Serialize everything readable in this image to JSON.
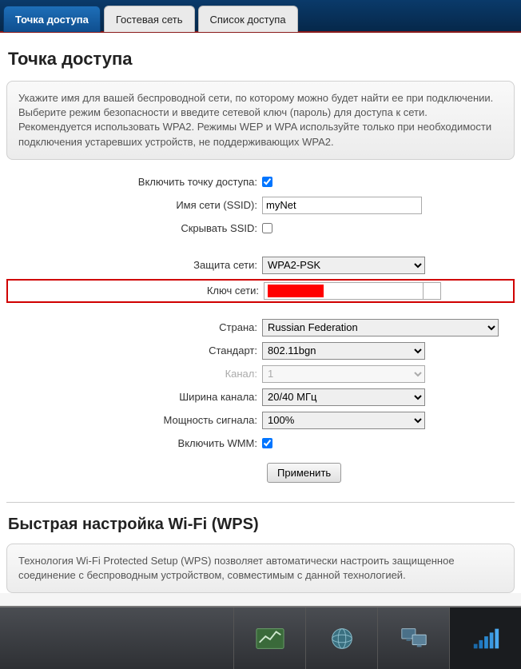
{
  "tabs": {
    "items": [
      {
        "label": "Точка доступа",
        "active": true
      },
      {
        "label": "Гостевая сеть",
        "active": false
      },
      {
        "label": "Список доступа",
        "active": false
      }
    ]
  },
  "page": {
    "title": "Точка доступа",
    "intro": "Укажите имя для вашей беспроводной сети, по которому можно будет найти ее при подключении. Выберите режим безопасности и введите сетевой ключ (пароль) для доступа к сети. Рекомендуется использовать WPA2. Режимы WEP и WPA используйте только при необходимости подключения устаревших устройств, не поддерживающих WPA2."
  },
  "form": {
    "enable_label": "Включить точку доступа:",
    "enable_checked": true,
    "ssid_label": "Имя сети (SSID):",
    "ssid_value": "myNet",
    "hide_ssid_label": "Скрывать SSID:",
    "hide_ssid_checked": false,
    "security_label": "Защита сети:",
    "security_value": "WPA2-PSK",
    "key_label": "Ключ сети:",
    "country_label": "Страна:",
    "country_value": "Russian Federation",
    "standard_label": "Стандарт:",
    "standard_value": "802.11bgn",
    "channel_label": "Канал:",
    "channel_value": "1",
    "width_label": "Ширина канала:",
    "width_value": "20/40 МГц",
    "power_label": "Мощность сигнала:",
    "power_value": "100%",
    "wmm_label": "Включить WMM:",
    "wmm_checked": true,
    "apply_label": "Применить"
  },
  "wps": {
    "title": "Быстрая настройка Wi-Fi (WPS)",
    "intro": "Технология Wi-Fi Protected Setup (WPS) позволяет автоматически настроить защищенное соединение с беспроводным устройством, совместимым с данной технологией."
  }
}
